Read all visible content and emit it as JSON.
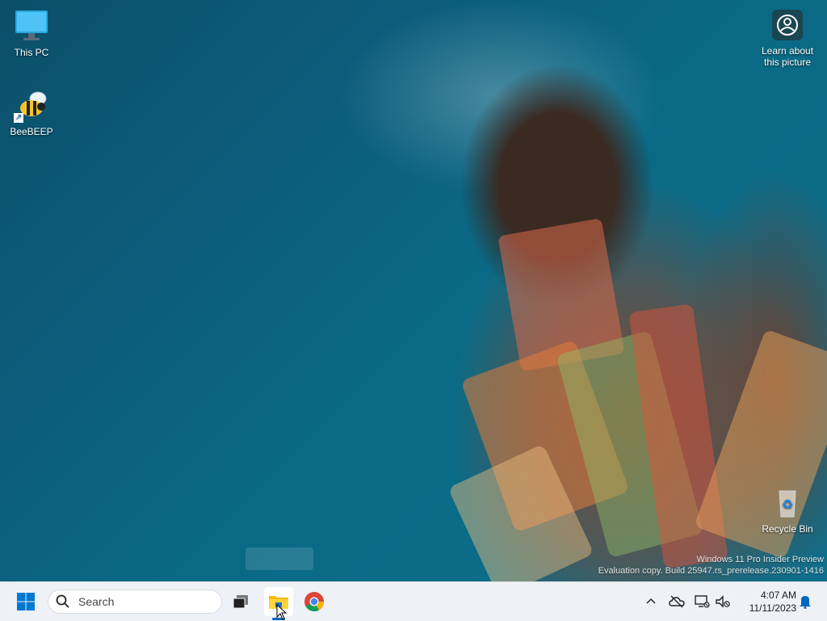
{
  "desktop": {
    "icons": [
      {
        "label": "This PC",
        "icon": "computer-icon"
      },
      {
        "label": "BeeBEEP",
        "icon": "bee-icon"
      },
      {
        "label": "Recycle Bin",
        "icon": "recycle-bin-icon"
      }
    ],
    "learn_about": {
      "label_line1": "Learn about",
      "label_line2": "this picture",
      "icon": "camera-icon"
    },
    "watermark": {
      "line1": "Windows 11 Pro Insider Preview",
      "line2": "Evaluation copy. Build 25947.rs_prerelease.230901-1416"
    }
  },
  "taskbar": {
    "start": {
      "icon": "windows-logo-icon"
    },
    "search": {
      "placeholder": "Search",
      "icon": "search-icon"
    },
    "apps": [
      {
        "name": "Task View",
        "icon": "task-view-icon"
      },
      {
        "name": "File Explorer",
        "icon": "folder-icon",
        "active": true
      },
      {
        "name": "Google Chrome",
        "icon": "chrome-icon"
      }
    ],
    "tray": {
      "icons": [
        "chevron-up-icon",
        "onedrive-offline-icon",
        "network-disconnected-icon",
        "volume-muted-icon"
      ],
      "time": "4:07 AM",
      "date": "11/11/2023",
      "notification_icon": "bell-icon"
    }
  },
  "colors": {
    "accent": "#0067c0",
    "taskbar": "#eef1f5"
  }
}
